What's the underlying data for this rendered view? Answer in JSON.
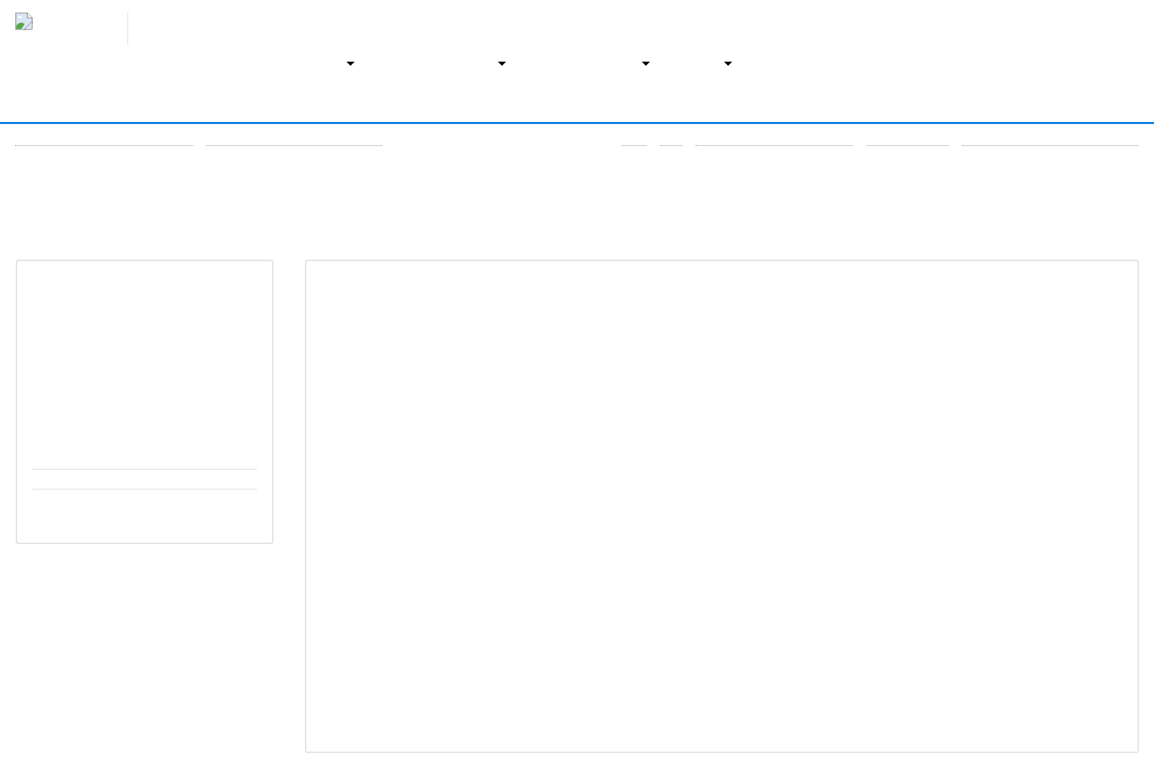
{
  "header": {
    "logo": {
      "kind": "broken_image"
    }
  },
  "nav_menus": [
    {
      "dropdown": true
    },
    {
      "dropdown": true
    },
    {
      "dropdown": true
    },
    {
      "dropdown": true
    }
  ],
  "toolbar": {
    "left_links": [
      {
        "kind": "link"
      },
      {
        "kind": "link"
      }
    ],
    "right_links": [
      {
        "kind": "link"
      },
      {
        "kind": "link"
      },
      {
        "kind": "link"
      },
      {
        "kind": "link"
      },
      {
        "kind": "link"
      }
    ]
  },
  "panels": [
    {
      "kind": "sidebar"
    },
    {
      "kind": "main"
    }
  ]
}
